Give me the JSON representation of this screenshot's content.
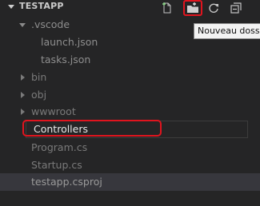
{
  "explorer": {
    "title": "TESTAPP"
  },
  "toolbar": {
    "new_file_icon": "new-file-icon",
    "new_folder_icon": "new-folder-icon",
    "refresh_icon": "refresh-icon",
    "collapse_icon": "collapse-all-icon"
  },
  "tooltip": {
    "text": "Nouveau dossier"
  },
  "tree": {
    "vscode": ".vscode",
    "launch": "launch.json",
    "tasks": "tasks.json",
    "bin": "bin",
    "obj": "obj",
    "wwwroot": "wwwroot",
    "controllers": "Controllers",
    "program": "Program.cs",
    "startup": "Startup.cs",
    "csproj": "testapp.csproj"
  },
  "colors": {
    "background": "#252526",
    "highlight": "#e0141e",
    "selected_row": "#37373d"
  }
}
